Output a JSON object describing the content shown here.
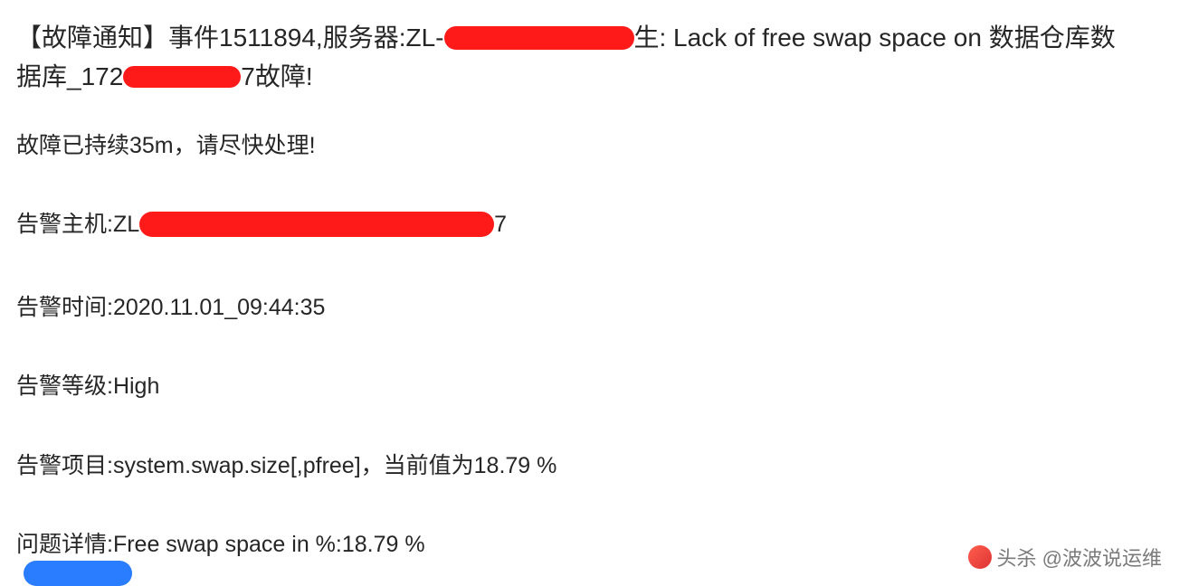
{
  "title": {
    "prefix": "【故障通知】事件1511894,服务器:ZL-",
    "mid1": "生: Lack of free swap space on 数据仓库数",
    "line2a": "据库_172",
    "line2b": "7故障!"
  },
  "duration": "故障已持续35m，请尽快处理!",
  "host": {
    "label": "告警主机:ZL",
    "suffix": "7"
  },
  "time": "告警时间:2020.11.01_09:44:35",
  "level": "告警等级:High",
  "item": "告警项目:system.swap.size[,pfree]，当前值为18.79 %",
  "detail": "问题详情:Free swap space in %:18.79 %",
  "watermark": "头杀 @波波说运维"
}
